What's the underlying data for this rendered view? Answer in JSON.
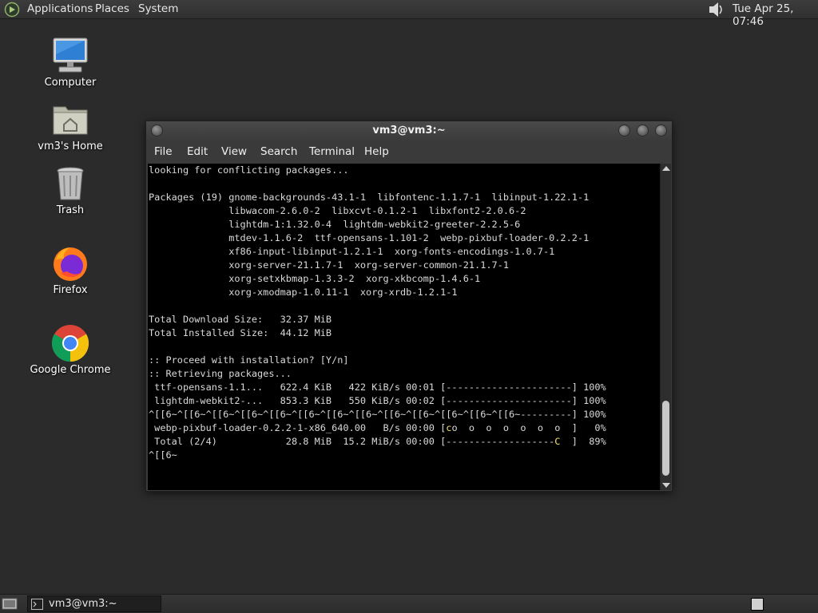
{
  "top_panel": {
    "menus": [
      "Applications",
      "Places",
      "System"
    ],
    "clock": "Tue Apr 25, 07:46"
  },
  "desktop_icons": [
    {
      "label": "Computer",
      "icon": "computer-icon"
    },
    {
      "label": "vm3's Home",
      "icon": "home-folder-icon"
    },
    {
      "label": "Trash",
      "icon": "trash-icon"
    },
    {
      "label": "Firefox",
      "icon": "firefox-icon"
    },
    {
      "label": "Google Chrome",
      "icon": "chrome-icon"
    }
  ],
  "window": {
    "title": "vm3@vm3:~",
    "menus": [
      "File",
      "Edit",
      "View",
      "Search",
      "Terminal",
      "Help"
    ],
    "terminal_lines": [
      "looking for conflicting packages...",
      "",
      "Packages (19) gnome-backgrounds-43.1-1  libfontenc-1.1.7-1  libinput-1.22.1-1",
      "              libwacom-2.6.0-2  libxcvt-0.1.2-1  libxfont2-2.0.6-2",
      "              lightdm-1:1.32.0-4  lightdm-webkit2-greeter-2.2.5-6",
      "              mtdev-1.1.6-2  ttf-opensans-1.101-2  webp-pixbuf-loader-0.2.2-1",
      "              xf86-input-libinput-1.2.1-1  xorg-fonts-encodings-1.0.7-1",
      "              xorg-server-21.1.7-1  xorg-server-common-21.1.7-1",
      "              xorg-setxkbmap-1.3.3-2  xorg-xkbcomp-1.4.6-1",
      "              xorg-xmodmap-1.0.11-1  xorg-xrdb-1.2.1-1",
      "",
      "Total Download Size:   32.37 MiB",
      "Total Installed Size:  44.12 MiB",
      "",
      ":: Proceed with installation? [Y/n]",
      ":: Retrieving packages...",
      " ttf-opensans-1.1...   622.4 KiB   422 KiB/s 00:01 [----------------------] 100%",
      " lightdm-webkit2-...   853.3 KiB   550 KiB/s 00:02 [----------------------] 100%",
      "^[[6~^[[6~^[[6~^[[6~^[[6~^[[6~^[[6~^[[6~^[[6~^[[6~^[[6~^[[6~^[[6~---------] 100%",
      " webp-pixbuf-loader-0.2.2-1-x86_640.00   B/s 00:00 [co  o  o  o  o  o  o  ]   0%",
      " Total (2/4)            28.8 MiB  15.2 MiB/s 00:00 [-------------------C  ]  89%",
      "^[[6~"
    ]
  },
  "taskbar": {
    "task_label": "vm3@vm3:~"
  }
}
